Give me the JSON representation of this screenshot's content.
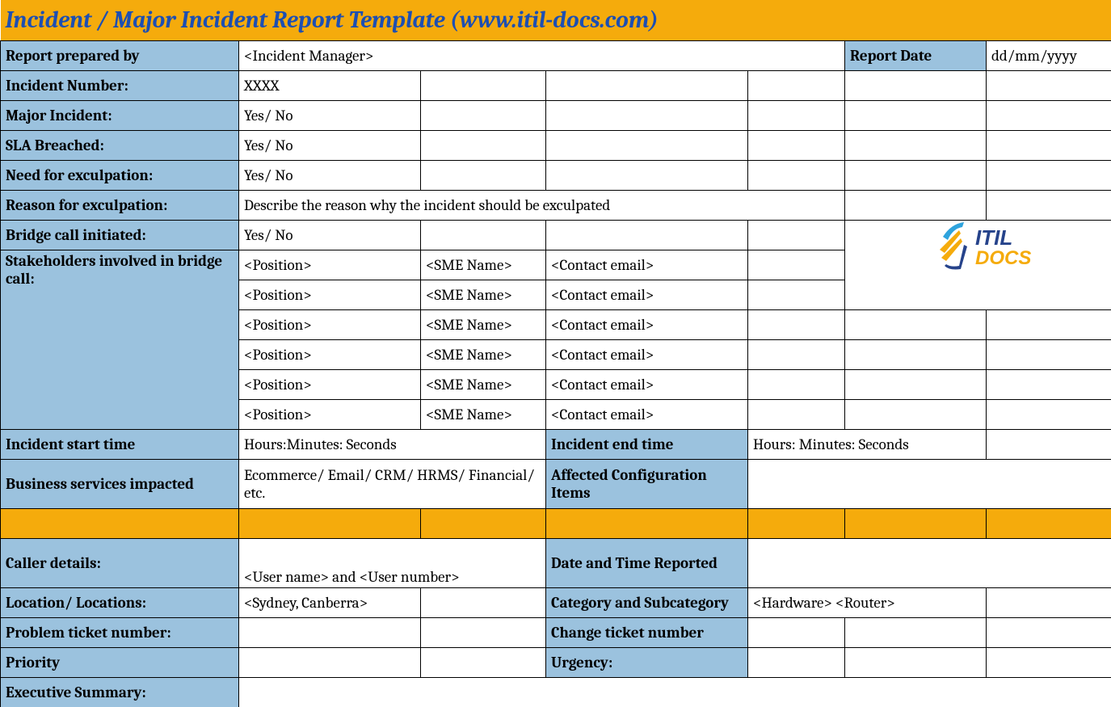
{
  "title": "Incident / Major Incident Report Template   (www.itil-docs.com)",
  "rows": {
    "reportBy": "Report prepared by",
    "reportByVal": "<Incident Manager>",
    "reportDate": "Report Date",
    "reportDateVal": "dd/mm/yyyy",
    "incidentNumber": "Incident Number:",
    "incidentNumberVal": "XXXX",
    "majorIncident": "Major Incident:",
    "majorIncidentVal": "Yes/ No",
    "slaBreached": "SLA Breached:",
    "slaBreachedVal": "Yes/ No",
    "needExcul": "Need for exculpation:",
    "needExculVal": "Yes/ No",
    "reasonExcul": "Reason for exculpation:",
    "reasonExculVal": "Describe the reason why the incident should be exculpated",
    "bridgeCall": "Bridge call initiated:",
    "bridgeCallVal": "Yes/ No",
    "stakeholders": "Stakeholders involved in bridge call:",
    "position": "<Position>",
    "sme": "<SME Name>",
    "email": "<Contact email>",
    "startTime": "Incident start time",
    "startTimeVal": "Hours:Minutes: Seconds",
    "endTime": "Incident end time",
    "endTimeVal": "Hours: Minutes: Seconds",
    "bizServices": "Business services impacted",
    "bizServicesVal": "Ecommerce/ Email/ CRM/ HRMS/ Financial/ etc.",
    "affectedCI": "Affected Configuration Items",
    "callerDetails": "Caller details:",
    "callerDetailsVal": "<User name> and <User number>",
    "dtReported": "Date and Time Reported",
    "location": "Location/ Locations:",
    "locationVal": "<Sydney, Canberra>",
    "catSubcat": "Category and Subcategory",
    "catSubcatVal": "<Hardware> <Router>",
    "probTicket": "Problem ticket number:",
    "chgTicket": "Change ticket number",
    "priority": "Priority",
    "urgency": "Urgency:",
    "execSummary": "Executive Summary:"
  },
  "logoText1": "ITIL",
  "logoText2": "DOCS"
}
